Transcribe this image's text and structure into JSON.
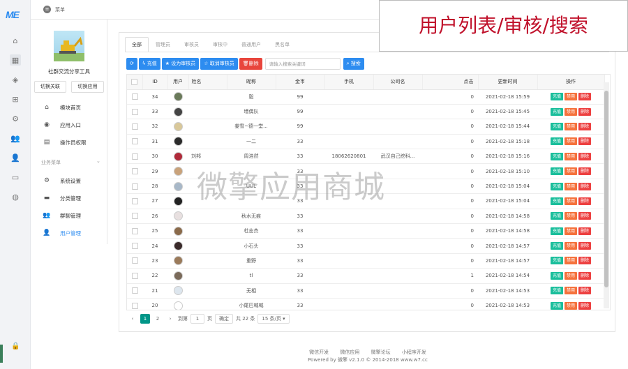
{
  "brand": {
    "logo_text": "ME"
  },
  "topbar": {
    "menu_label": "菜单"
  },
  "rail_icons": [
    "home-icon",
    "grid-icon",
    "cube-icon",
    "apps-icon",
    "settings-icon",
    "users-icon",
    "user-cog-icon",
    "monitor-icon",
    "globe-icon"
  ],
  "sidebar": {
    "app_name": "社群交流分享工具",
    "switch_link_label": "切换关联",
    "switch_app_label": "切换应用",
    "items": [
      {
        "label": "模块首页",
        "icon": "home-icon"
      },
      {
        "label": "应用入口",
        "icon": "chat-icon"
      },
      {
        "label": "操作员权限",
        "icon": "file-lock-icon"
      }
    ],
    "section_label": "业务菜单",
    "biz_items": [
      {
        "label": "系统设置",
        "icon": "gear-icon"
      },
      {
        "label": "分类管理",
        "icon": "folder-icon"
      },
      {
        "label": "群聊管理",
        "icon": "group-icon"
      },
      {
        "label": "用户管理",
        "icon": "user-icon"
      }
    ]
  },
  "tabs": [
    "全部",
    "管理员",
    "审核员",
    "审核中",
    "普通用户",
    "黑名单"
  ],
  "toolbar": {
    "recharge": "充值",
    "set_auditor": "设为审核员",
    "cancel_auditor": "取消审核员",
    "delete": "删除",
    "search_placeholder": "请输入搜索关键词",
    "search": "搜索"
  },
  "table": {
    "headers": [
      "ID",
      "用户",
      "姓名",
      "昵称",
      "金币",
      "手机",
      "公司名",
      "点击",
      "更新时间",
      "操作"
    ],
    "row_actions": [
      "充值",
      "禁用",
      "删除"
    ],
    "rows": [
      {
        "id": "34",
        "avatar": "#6a7a5a",
        "name": "",
        "nick": "毅",
        "coins": "99",
        "phone": "",
        "company": "",
        "clicks": "0",
        "time": "2021-02-18 15:59"
      },
      {
        "id": "33",
        "avatar": "#444444",
        "name": "",
        "nick": "墙偶队",
        "coins": "99",
        "phone": "",
        "company": "",
        "clicks": "0",
        "time": "2021-02-18 15:45"
      },
      {
        "id": "32",
        "avatar": "#d9c89a",
        "name": "",
        "nick": "姜雪~德一堂...",
        "coins": "99",
        "phone": "",
        "company": "",
        "clicks": "0",
        "time": "2021-02-18 15:44"
      },
      {
        "id": "31",
        "avatar": "#2b2b2b",
        "name": "",
        "nick": "一二",
        "coins": "33",
        "phone": "",
        "company": "",
        "clicks": "0",
        "time": "2021-02-18 15:18"
      },
      {
        "id": "30",
        "avatar": "#b02a3a",
        "name": "刘邦",
        "nick": "周浩然",
        "coins": "33",
        "phone": "18062620801",
        "company": "武汉自己挖科...",
        "clicks": "0",
        "time": "2021-02-18 15:16"
      },
      {
        "id": "29",
        "avatar": "#c9a27a",
        "name": "",
        "nick": "",
        "coins": "33",
        "phone": "",
        "company": "",
        "clicks": "0",
        "time": "2021-02-18 15:10"
      },
      {
        "id": "28",
        "avatar": "#a8b8c8",
        "name": "",
        "nick": "UUL",
        "coins": "33",
        "phone": "",
        "company": "",
        "clicks": "0",
        "time": "2021-02-18 15:04"
      },
      {
        "id": "27",
        "avatar": "#222222",
        "name": "",
        "nick": "",
        "coins": "33",
        "phone": "",
        "company": "",
        "clicks": "0",
        "time": "2021-02-18 15:04"
      },
      {
        "id": "26",
        "avatar": "#e8e0e0",
        "name": "",
        "nick": "秋水无痕",
        "coins": "33",
        "phone": "",
        "company": "",
        "clicks": "0",
        "time": "2021-02-18 14:58"
      },
      {
        "id": "25",
        "avatar": "#8a6a4a",
        "name": "",
        "nick": "杜志杰",
        "coins": "33",
        "phone": "",
        "company": "",
        "clicks": "0",
        "time": "2021-02-18 14:58"
      },
      {
        "id": "24",
        "avatar": "#3a2a2a",
        "name": "",
        "nick": "小石头",
        "coins": "33",
        "phone": "",
        "company": "",
        "clicks": "0",
        "time": "2021-02-18 14:57"
      },
      {
        "id": "23",
        "avatar": "#9a7a5a",
        "name": "",
        "nick": "重野",
        "coins": "33",
        "phone": "",
        "company": "",
        "clicks": "0",
        "time": "2021-02-18 14:57"
      },
      {
        "id": "22",
        "avatar": "#7a6a5a",
        "name": "",
        "nick": "tl",
        "coins": "33",
        "phone": "",
        "company": "",
        "clicks": "1",
        "time": "2021-02-18 14:54"
      },
      {
        "id": "21",
        "avatar": "#dde6ee",
        "name": "",
        "nick": "无相",
        "coins": "33",
        "phone": "",
        "company": "",
        "clicks": "0",
        "time": "2021-02-18 14:53"
      },
      {
        "id": "20",
        "avatar": "#ffffff",
        "name": "",
        "nick": "小尾巴喊喊",
        "coins": "33",
        "phone": "",
        "company": "",
        "clicks": "0",
        "time": "2021-02-18 14:53"
      }
    ]
  },
  "pager": {
    "prev": "‹",
    "pages": [
      "1",
      "2"
    ],
    "next": "›",
    "goto_label": "到第",
    "goto_value": "1",
    "page_unit": "页",
    "confirm": "确定",
    "total": "共 22 条",
    "page_size": "15 条/页"
  },
  "footer": {
    "links": [
      "微信开发",
      "微信应用",
      "微擎论坛",
      "小程序开发"
    ],
    "copyright": "Powered by 微擎 v2.1.0 © 2014-2018 www.w7.cc"
  },
  "overlay": {
    "banner": "用户列表/审核/搜索",
    "watermark": "微擎应用商城"
  },
  "colors": {
    "primary": "#2d8cf0",
    "danger": "#e8453c",
    "green": "#19be9b",
    "orange": "#f5713b",
    "pager_active": "#009688"
  }
}
